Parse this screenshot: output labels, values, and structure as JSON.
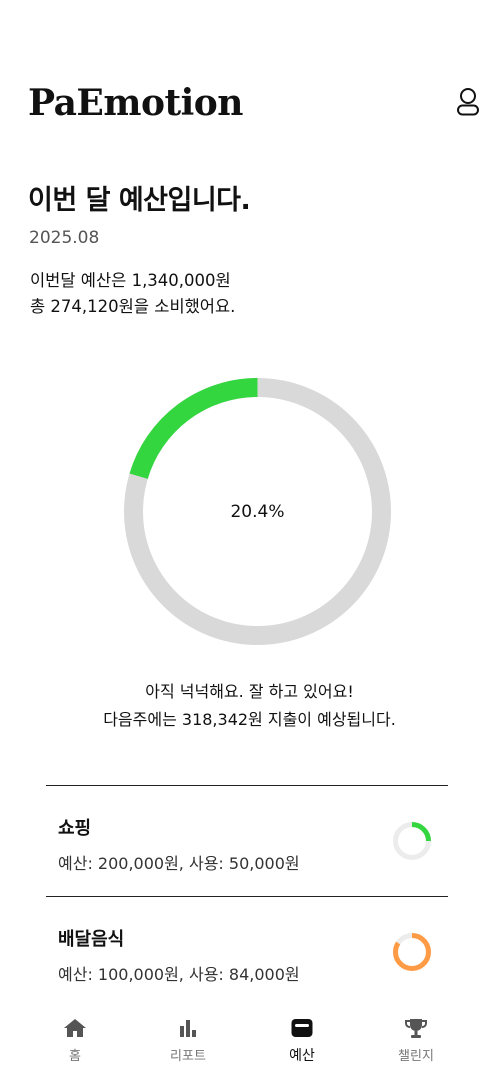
{
  "app": {
    "title": "PaEmotion"
  },
  "page": {
    "title": "이번 달 예산입니다.",
    "period": "2025.08",
    "summary_line1": "이번달 예산은 1,340,000원",
    "summary_line2": "총 274,120원을 소비했어요."
  },
  "budget_usage": {
    "percent": 20.4,
    "percent_label": "20.4%",
    "used_color": "#33d63f",
    "remaining_color": "#d9d9d9"
  },
  "message": {
    "line1": "아직 넉넉해요. 잘 하고 있어요!",
    "line2": "다음주에는 318,342원 지출이 예상됩니다."
  },
  "categories": [
    {
      "name": "쇼핑",
      "detail": "예산: 200,000원, 사용: 50,000원",
      "used_ratio": 0.25,
      "color": "#33d63f"
    },
    {
      "name": "배달음식",
      "detail": "예산: 100,000원, 사용: 84,000원",
      "used_ratio": 0.84,
      "color": "#ff9a45"
    }
  ],
  "tabs": [
    {
      "label": "홈",
      "icon": "home-icon"
    },
    {
      "label": "리포트",
      "icon": "bar-chart-icon"
    },
    {
      "label": "예산",
      "icon": "wallet-icon",
      "active": true
    },
    {
      "label": "챌린지",
      "icon": "trophy-icon"
    }
  ]
}
